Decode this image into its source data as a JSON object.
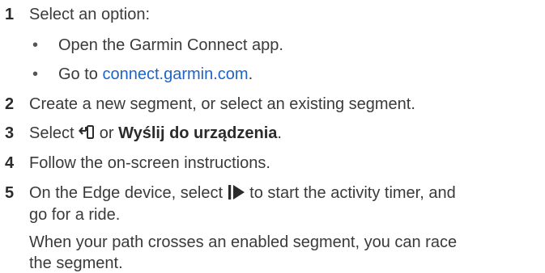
{
  "steps": [
    {
      "number": "1",
      "text": "Select an option:"
    },
    {
      "number": "2",
      "text": "Create a new segment, or select an existing segment."
    },
    {
      "number": "3",
      "before": "Select",
      "middle": "or",
      "bold": "Wyślij do urządzenia",
      "after": "."
    },
    {
      "number": "4",
      "text": "Follow the on-screen instructions."
    },
    {
      "number": "5",
      "before": "On the Edge device, select",
      "after": "to start the activity timer, and",
      "line2": "go for a ride."
    }
  ],
  "options": [
    {
      "bullet": "•",
      "text": "Open the Garmin Connect app."
    },
    {
      "bullet": "•",
      "before": "Go to",
      "link": "connect.garmin.com",
      "after": "."
    }
  ],
  "note": {
    "line1": "When your path crosses an enabled segment, you can race",
    "line2": "the segment."
  },
  "icons": {
    "send": "send-to-device-icon",
    "start": "start-timer-icon"
  },
  "colors": {
    "text": "#3a3a3a",
    "link": "#1e64c8"
  }
}
